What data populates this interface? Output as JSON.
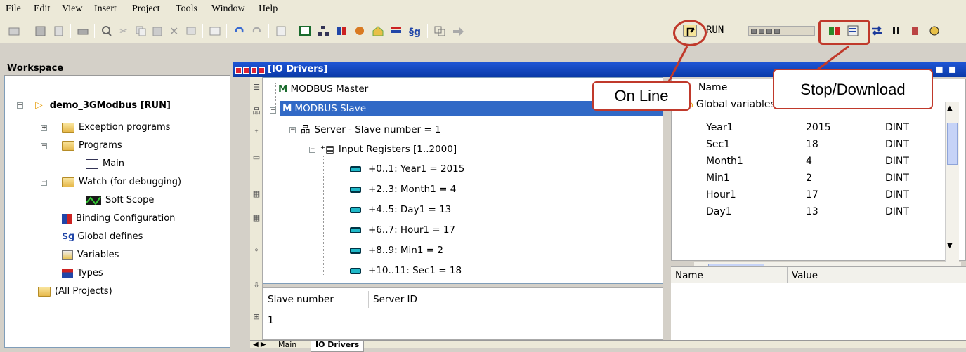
{
  "menu": [
    "File",
    "Edit",
    "View",
    "Insert",
    "Project",
    "Tools",
    "Window",
    "Help"
  ],
  "toolbar": {
    "run_label": "RUN"
  },
  "workspace": {
    "title": "Workspace",
    "project": "demo_3GModbus [RUN]",
    "items": [
      "Exception programs",
      "Programs",
      "Main",
      "Watch (for debugging)",
      "Soft Scope",
      "Binding Configuration",
      "Global defines",
      "Variables",
      "Types",
      "(All Projects)"
    ],
    "global_defines_icon": "$g"
  },
  "io_window": {
    "title": "[IO Drivers]",
    "master": "MODBUS Master",
    "slave": "MODBUS Slave",
    "master_icon_text": "M",
    "slave_icon_text": "M",
    "server": "Server - Slave number = 1",
    "registers": "Input Registers [1..2000]",
    "entries": [
      "+0..1: Year1 = 2015",
      "+2..3: Month1 = 4",
      "+4..5: Day1 = 13",
      "+6..7: Hour1 = 17",
      "+8..9: Min1 = 2",
      "+10..11: Sec1 = 18"
    ],
    "grid_headers": [
      "Slave number",
      "Server ID"
    ],
    "grid_value": "1"
  },
  "tabs": [
    "Main",
    "IO Drivers"
  ],
  "variables": {
    "name_header": "Name",
    "group": "Global variables",
    "rows": [
      {
        "name": "Year1",
        "value": "2015",
        "type": "DINT"
      },
      {
        "name": "Sec1",
        "value": "18",
        "type": "DINT"
      },
      {
        "name": "Month1",
        "value": "4",
        "type": "DINT"
      },
      {
        "name": "Min1",
        "value": "2",
        "type": "DINT"
      },
      {
        "name": "Hour1",
        "value": "17",
        "type": "DINT"
      },
      {
        "name": "Day1",
        "value": "13",
        "type": "DINT"
      }
    ]
  },
  "watch": {
    "headers": [
      "Name",
      "Value"
    ]
  },
  "callouts": {
    "online": "On Line",
    "stop_download": "Stop/Download"
  },
  "colors": {
    "accent_red": "#c0392b",
    "selection": "#3169c6",
    "title_blue": "#0a3aa8"
  }
}
